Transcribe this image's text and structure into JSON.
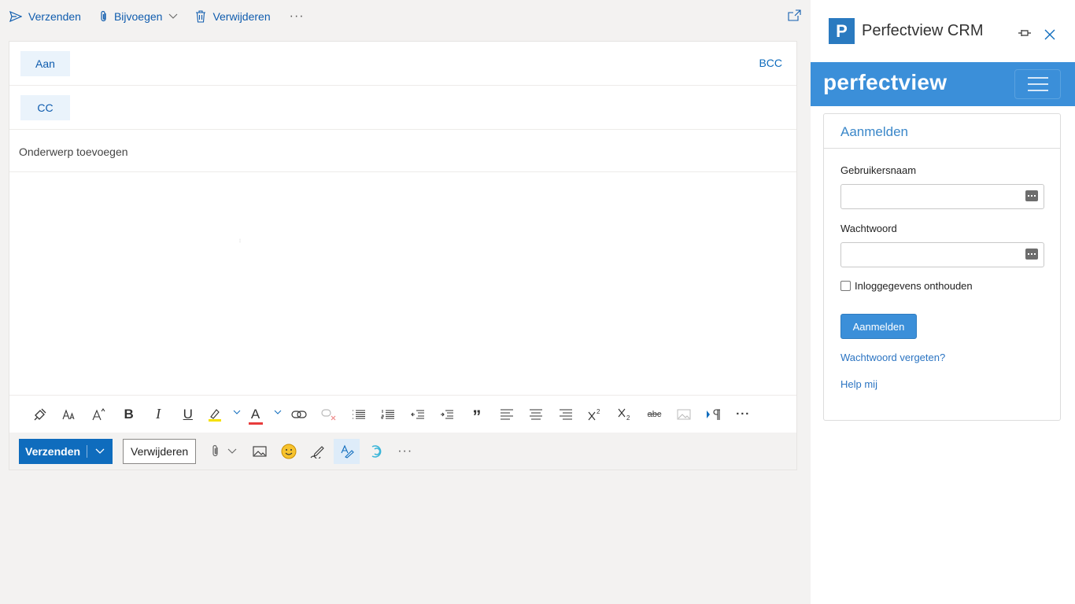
{
  "toolbar": {
    "send_label": "Verzenden",
    "attach_label": "Bijvoegen",
    "delete_label": "Verwijderen",
    "more_label": "···"
  },
  "recipients": {
    "to_label": "Aan",
    "cc_label": "CC",
    "bcc_label": "BCC"
  },
  "subject": {
    "placeholder": "Onderwerp toevoegen"
  },
  "format_bar": {
    "icons": [
      "format-painter-icon",
      "font-size-icon",
      "grow-font-icon",
      "bold-icon",
      "italic-icon",
      "underline-icon",
      "highlight-icon",
      "font-color-icon",
      "insert-link-icon",
      "remove-link-icon",
      "bullets-icon",
      "numbering-icon",
      "decrease-indent-icon",
      "increase-indent-icon",
      "quote-icon",
      "align-left-icon",
      "align-center-icon",
      "align-right-icon",
      "superscript-icon",
      "subscript-icon",
      "strikethrough-icon",
      "picture-icon",
      "paragraph-direction-icon",
      "more-icon"
    ],
    "bold": "B",
    "italic": "I",
    "underline": "U",
    "font_color": "A",
    "quote": "”",
    "strike": "abc",
    "more": "···"
  },
  "action_bar": {
    "send_label": "Verzenden",
    "discard_label": "Verwijderen",
    "more_label": "···"
  },
  "addin": {
    "title": "Perfectview CRM",
    "logo_letter": "P",
    "wordmark": "perfectview",
    "accent_color": "#3b8fd9",
    "login": {
      "heading": "Aanmelden",
      "username_label": "Gebruikersnaam",
      "username_value": "",
      "password_label": "Wachtwoord",
      "password_value": "",
      "remember_label": "Inloggegevens onthouden",
      "remember_checked": false,
      "submit_label": "Aanmelden",
      "forgot_link": "Wachtwoord vergeten?",
      "help_link": "Help mij"
    }
  },
  "colors": {
    "outlook_blue": "#0f6cbd",
    "pane_blue": "#3b8fd9"
  }
}
